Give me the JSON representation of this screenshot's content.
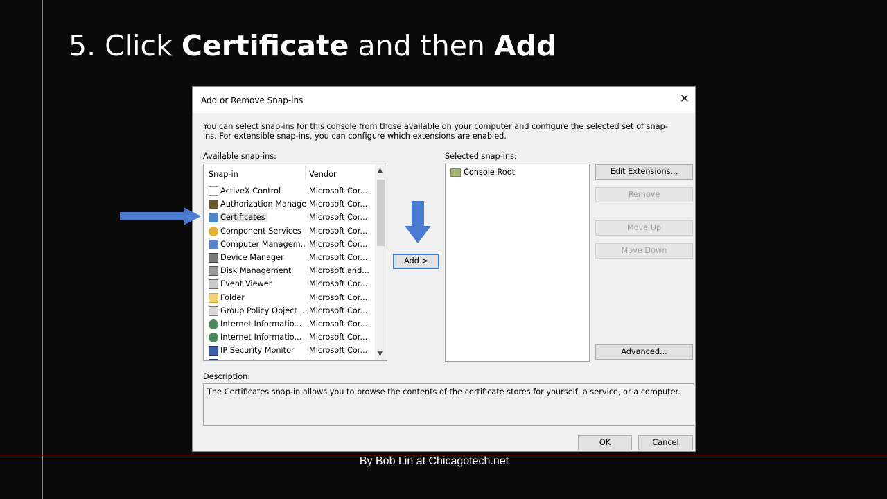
{
  "slide": {
    "title_prefix": "5. Click ",
    "title_bold1": "Certificate",
    "title_mid": " and then ",
    "title_bold2": "Add",
    "footer": "By Bob Lin at Chicagotech.net"
  },
  "dialog": {
    "title": "Add or Remove Snap-ins",
    "intro": "You can select snap-ins for this console from those available on your computer and configure the selected set of snap-ins. For extensible snap-ins, you can configure which extensions are enabled.",
    "available_label": "Available snap-ins:",
    "selected_label": "Selected snap-ins:",
    "columns": {
      "snapin": "Snap-in",
      "vendor": "Vendor"
    },
    "snapins": [
      {
        "name": "ActiveX Control",
        "vendor": "Microsoft Cor...",
        "icon": "activex-icon"
      },
      {
        "name": "Authorization Manager",
        "vendor": "Microsoft Cor...",
        "icon": "authorization-manager-icon"
      },
      {
        "name": "Certificates",
        "vendor": "Microsoft Cor...",
        "icon": "certificates-icon",
        "selected": true
      },
      {
        "name": "Component Services",
        "vendor": "Microsoft Cor...",
        "icon": "component-services-icon"
      },
      {
        "name": "Computer Managem...",
        "vendor": "Microsoft Cor...",
        "icon": "computer-management-icon"
      },
      {
        "name": "Device Manager",
        "vendor": "Microsoft Cor...",
        "icon": "device-manager-icon"
      },
      {
        "name": "Disk Management",
        "vendor": "Microsoft and...",
        "icon": "disk-management-icon"
      },
      {
        "name": "Event Viewer",
        "vendor": "Microsoft Cor...",
        "icon": "event-viewer-icon"
      },
      {
        "name": "Folder",
        "vendor": "Microsoft Cor...",
        "icon": "folder-icon"
      },
      {
        "name": "Group Policy Object ...",
        "vendor": "Microsoft Cor...",
        "icon": "group-policy-icon"
      },
      {
        "name": "Internet Informatio...",
        "vendor": "Microsoft Cor...",
        "icon": "iis-icon"
      },
      {
        "name": "Internet Informatio...",
        "vendor": "Microsoft Cor...",
        "icon": "iis-icon"
      },
      {
        "name": "IP Security Monitor",
        "vendor": "Microsoft Cor...",
        "icon": "ip-security-icon"
      },
      {
        "name": "IP Security Policy M...",
        "vendor": "Microsoft Cor...",
        "icon": "ip-security-policy-icon"
      }
    ],
    "selected_items": [
      {
        "name": "Console Root",
        "icon": "folder-icon"
      }
    ],
    "buttons": {
      "add": "Add >",
      "edit_extensions": "Edit Extensions...",
      "remove": "Remove",
      "move_up": "Move Up",
      "move_down": "Move Down",
      "advanced": "Advanced...",
      "ok": "OK",
      "cancel": "Cancel"
    },
    "description_label": "Description:",
    "description": "The Certificates snap-in allows you to browse the contents of the certificate stores for yourself, a service, or a computer."
  },
  "annotations": {
    "arrow_color": "#4a7bd0"
  }
}
